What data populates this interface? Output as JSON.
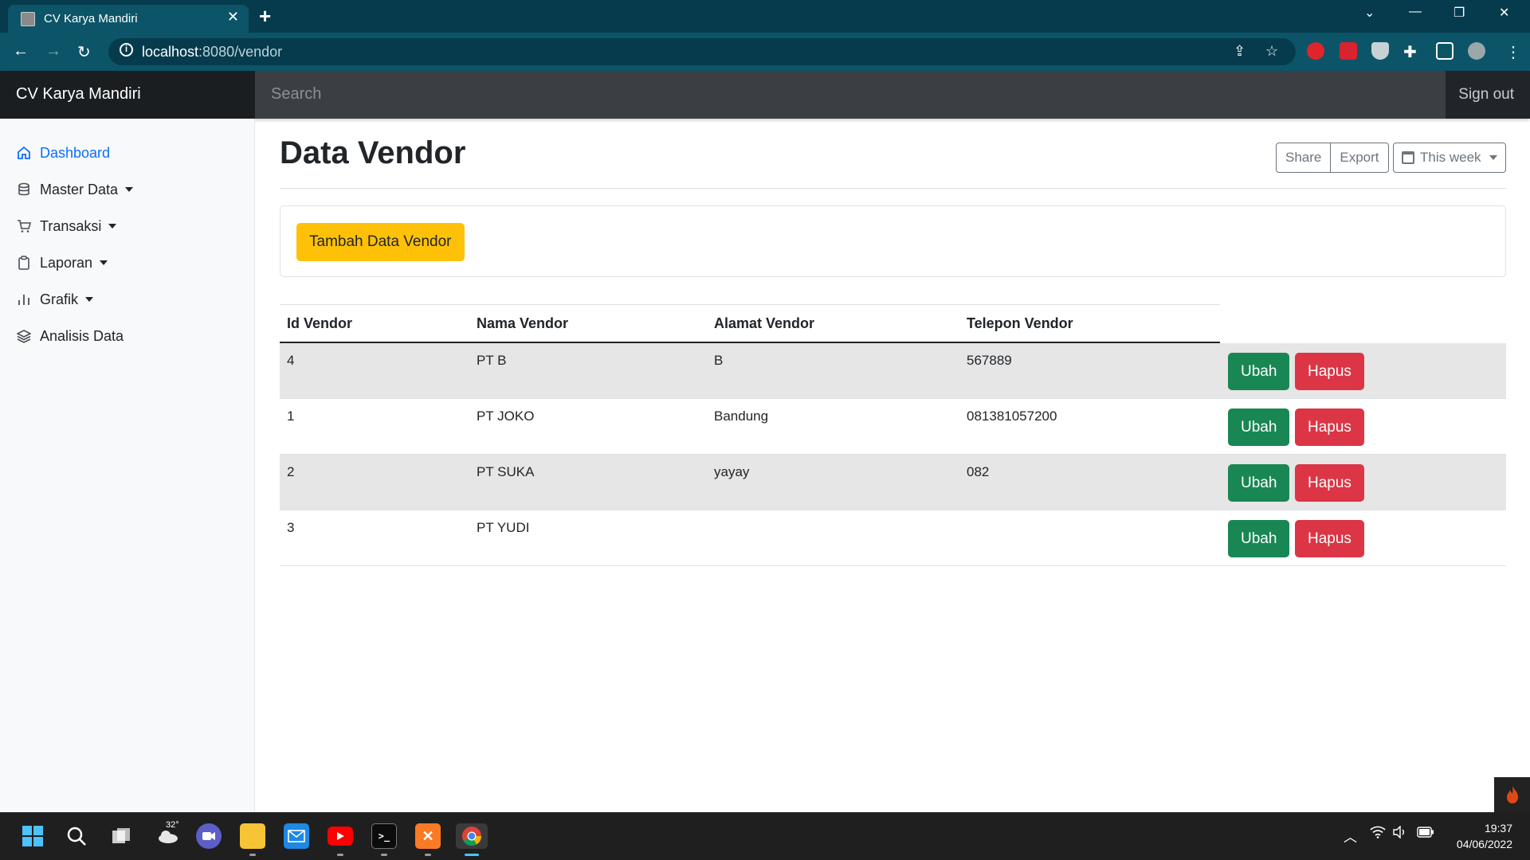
{
  "browser": {
    "tab_title": "CV Karya Mandiri",
    "url_host": "localhost",
    "url_path": ":8080/vendor"
  },
  "navbar": {
    "brand": "CV Karya Mandiri",
    "search_placeholder": "Search",
    "sign_out": "Sign out"
  },
  "sidebar": {
    "items": [
      {
        "label": "Dashboard",
        "icon": "home-icon",
        "active": true
      },
      {
        "label": "Master Data",
        "icon": "database-icon",
        "dropdown": true
      },
      {
        "label": "Transaksi",
        "icon": "cart-icon",
        "dropdown": true
      },
      {
        "label": "Laporan",
        "icon": "clipboard-icon",
        "dropdown": true
      },
      {
        "label": "Grafik",
        "icon": "bar-chart-icon",
        "dropdown": true
      },
      {
        "label": "Analisis Data",
        "icon": "layers-icon"
      }
    ]
  },
  "main": {
    "title": "Data Vendor",
    "share_label": "Share",
    "export_label": "Export",
    "period_label": "This week",
    "add_button": "Tambah Data Vendor",
    "table": {
      "headers": [
        "Id Vendor",
        "Nama Vendor",
        "Alamat Vendor",
        "Telepon Vendor"
      ],
      "rows": [
        {
          "id": "4",
          "nama": "PT B",
          "alamat": "B",
          "telepon": "567889"
        },
        {
          "id": "1",
          "nama": "PT JOKO",
          "alamat": "Bandung",
          "telepon": "081381057200"
        },
        {
          "id": "2",
          "nama": "PT SUKA",
          "alamat": "yayay",
          "telepon": "082"
        },
        {
          "id": "3",
          "nama": "PT YUDI",
          "alamat": "",
          "telepon": ""
        }
      ],
      "edit_label": "Ubah",
      "delete_label": "Hapus"
    }
  },
  "taskbar": {
    "weather_temp": "32°",
    "time": "19:37",
    "date": "04/06/2022"
  },
  "colors": {
    "primary": "#0d6efd",
    "warning": "#ffc107",
    "success": "#198754",
    "danger": "#dc3545",
    "navbar": "#212529",
    "chrome_accent": "#0c5568"
  }
}
